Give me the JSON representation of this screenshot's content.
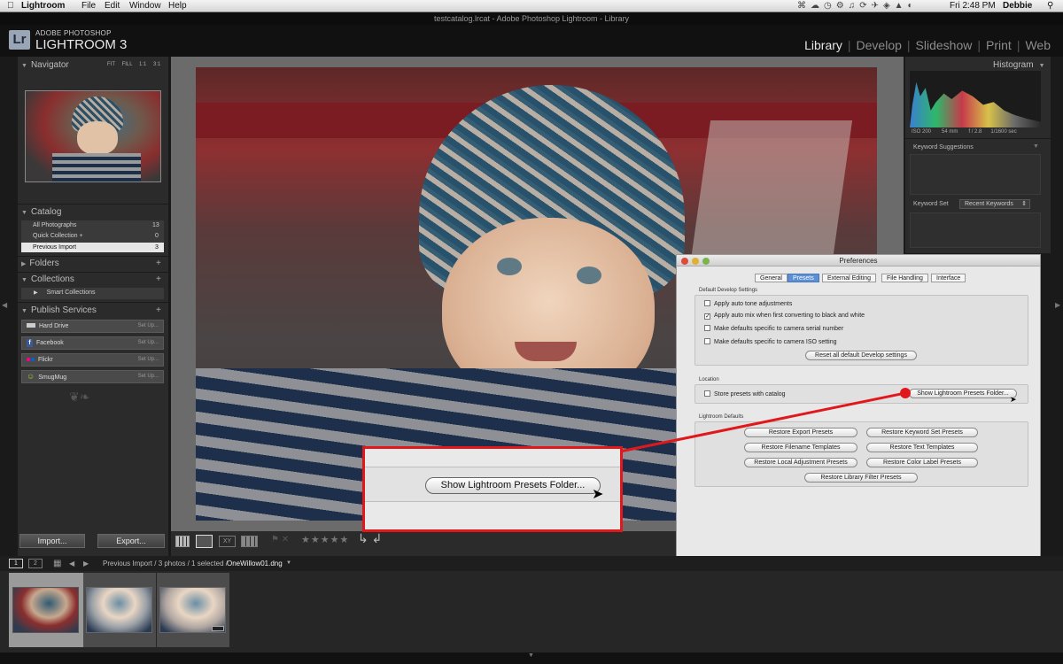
{
  "menubar": {
    "app": "Lightroom",
    "menus": [
      "File",
      "Edit",
      "Window",
      "Help"
    ],
    "clock": "Fri 2:48 PM",
    "user": "Debbie"
  },
  "window_title": "testcatalog.lrcat - Adobe Photoshop Lightroom - Library",
  "header": {
    "logo": "Lr",
    "brand_line1": "ADOBE PHOTOSHOP",
    "brand_line2": "LIGHTROOM 3",
    "modules": [
      "Library",
      "Develop",
      "Slideshow",
      "Print",
      "Web"
    ],
    "active_module": "Library"
  },
  "navigator": {
    "title": "Navigator",
    "zoom_options": [
      "FIT",
      "FILL",
      "1:1",
      "3:1"
    ]
  },
  "catalog": {
    "title": "Catalog",
    "items": [
      {
        "label": "All Photographs",
        "count": "13"
      },
      {
        "label": "Quick Collection +",
        "count": "0"
      },
      {
        "label": "Previous Import",
        "count": "3"
      }
    ]
  },
  "folders": {
    "title": "Folders"
  },
  "collections": {
    "title": "Collections",
    "items": [
      "Smart Collections"
    ]
  },
  "publish": {
    "title": "Publish Services",
    "items": [
      {
        "label": "Hard Drive",
        "action": "Set Up..."
      },
      {
        "label": "Facebook",
        "action": "Set Up..."
      },
      {
        "label": "Flickr",
        "action": "Set Up..."
      },
      {
        "label": "SmugMug",
        "action": "Set Up..."
      }
    ]
  },
  "left_buttons": {
    "import": "Import...",
    "export": "Export..."
  },
  "histogram": {
    "title": "Histogram",
    "iso": "ISO 200",
    "focal": "54 mm",
    "aperture": "f / 2.8",
    "shutter": "1/1600 sec"
  },
  "keywording": {
    "suggestions": "Keyword Suggestions",
    "set_label": "Keyword Set",
    "set_value": "Recent Keywords"
  },
  "preferences": {
    "title": "Preferences",
    "tabs": [
      "General",
      "Presets",
      "External Editing",
      "File Handling",
      "Interface"
    ],
    "active_tab": "Presets",
    "develop_group": "Default Develop Settings",
    "develop_checks": [
      {
        "label": "Apply auto tone adjustments",
        "checked": false
      },
      {
        "label": "Apply auto mix when first converting to black and white",
        "checked": true
      },
      {
        "label": "Make defaults specific to camera serial number",
        "checked": false
      },
      {
        "label": "Make defaults specific to camera ISO setting",
        "checked": false
      }
    ],
    "reset_button": "Reset all default Develop settings",
    "location_group": "Location",
    "store_presets": "Store presets with catalog",
    "show_folder_button": "Show Lightroom Presets Folder...",
    "defaults_group": "Lightroom Defaults",
    "restore_buttons": [
      "Restore Export Presets",
      "Restore Keyword Set Presets",
      "Restore Filename Templates",
      "Restore Text Templates",
      "Restore Local Adjustment Presets",
      "Restore Color Label Presets",
      "Restore Library Filter Presets"
    ]
  },
  "callout": {
    "button": "Show Lightroom Presets Folder..."
  },
  "filmstrip": {
    "pages": [
      "1",
      "2"
    ],
    "path": "Previous Import / 3 photos / 1 selected /",
    "filename": "OneWillow01.dng"
  },
  "colors": {
    "accent_red": "#e0181c",
    "panel": "#2b2b2b",
    "bg": "#1a1a1a"
  }
}
